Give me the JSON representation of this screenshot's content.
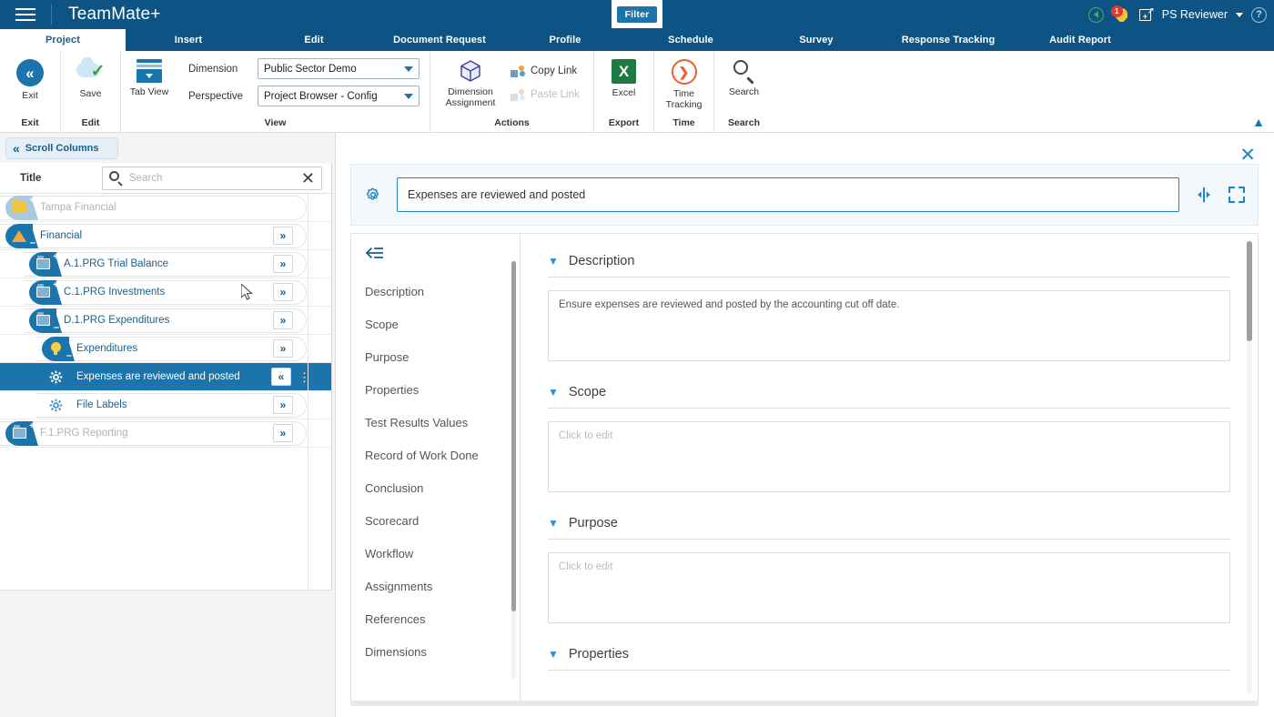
{
  "titlebar": {
    "app_title": "TeamMate+",
    "menu_icon": "hamburger-icon",
    "filter_label": "Filter",
    "user_name": "PS Reviewer",
    "notification_count": "1",
    "help_label": "?"
  },
  "ribbon_tabs": [
    {
      "label": "Project",
      "active": true
    },
    {
      "label": "Insert",
      "active": false
    },
    {
      "label": "Edit",
      "active": false
    },
    {
      "label": "Document Request",
      "active": false
    },
    {
      "label": "Profile",
      "active": false
    },
    {
      "label": "Schedule",
      "active": false
    },
    {
      "label": "Survey",
      "active": false
    },
    {
      "label": "Response Tracking",
      "active": false
    },
    {
      "label": "Audit Report",
      "active": false
    }
  ],
  "ribbon": {
    "groups": {
      "exit": {
        "group_label": "Exit",
        "button_label": "Exit"
      },
      "edit": {
        "group_label": "Edit",
        "button_label": "Save"
      },
      "view": {
        "group_label": "View",
        "tab_view_label": "Tab View",
        "dimension_label": "Dimension",
        "dimension_value": "Public Sector Demo",
        "perspective_label": "Perspective",
        "perspective_value": "Project Browser - Config"
      },
      "actions": {
        "group_label": "Actions",
        "dimension_assignment_label": "Dimension\nAssignment",
        "dimension_assignment_line1": "Dimension",
        "dimension_assignment_line2": "Assignment",
        "copy_link_label": "Copy Link",
        "paste_link_label": "Paste Link"
      },
      "export": {
        "group_label": "Export",
        "button_label": "Excel",
        "excel_glyph": "X"
      },
      "time": {
        "group_label": "Time",
        "line1": "Time",
        "line2": "Tracking"
      },
      "search": {
        "group_label": "Search",
        "button_label": "Search"
      }
    },
    "collapse_label": "^"
  },
  "left_pane": {
    "scroll_columns_label": "Scroll Columns",
    "column_header": "Title",
    "search_placeholder": "Search",
    "search_value": "",
    "rows": [
      {
        "label": "Tampa Financial",
        "indent": 0,
        "icon": "folder-plus-icon",
        "blob": "light",
        "disabled": true,
        "expand": "none",
        "selected": false
      },
      {
        "label": "Financial",
        "indent": 0,
        "icon": "triangle-icon",
        "blob": "blue",
        "disabled": false,
        "expand": "right",
        "selected": false
      },
      {
        "label": "A.1.PRG Trial Balance",
        "indent": 1,
        "icon": "folder-plus-icon",
        "blob": "blue",
        "disabled": false,
        "expand": "right",
        "selected": false
      },
      {
        "label": "C.1.PRG Investments",
        "indent": 1,
        "icon": "folder-plus-icon",
        "blob": "blue",
        "disabled": false,
        "expand": "right",
        "selected": false
      },
      {
        "label": "D.1.PRG Expenditures",
        "indent": 1,
        "icon": "folder-minus-icon",
        "blob": "blue",
        "disabled": false,
        "expand": "right",
        "selected": false
      },
      {
        "label": "Expenditures",
        "indent": 2,
        "icon": "bulb-icon",
        "blob": "blue",
        "disabled": false,
        "expand": "right",
        "selected": false
      },
      {
        "label": "Expenses are reviewed and posted",
        "indent": 3,
        "icon": "gear-white-icon",
        "blob": "none",
        "disabled": false,
        "expand": "left",
        "selected": true
      },
      {
        "label": "File Labels",
        "indent": 3,
        "icon": "gear-blue-icon",
        "blob": "none",
        "disabled": false,
        "expand": "right",
        "selected": false
      },
      {
        "label": "F.1.PRG Reporting",
        "indent": 0,
        "icon": "folder-plus-icon",
        "blob": "blue",
        "disabled": true,
        "expand": "right",
        "selected": false
      }
    ]
  },
  "detail": {
    "close_label": "✕",
    "gear_icon": "gear-icon",
    "title_value": "Expenses are reviewed and posted",
    "title_placeholder": "",
    "splitter_icon": "splitter-icon",
    "expand_icon": "fullscreen-icon",
    "collapse_nav_icon": "collapse-left-icon",
    "nav_items": [
      {
        "label": "Description"
      },
      {
        "label": "Scope"
      },
      {
        "label": "Purpose"
      },
      {
        "label": "Properties"
      },
      {
        "label": "Test Results Values"
      },
      {
        "label": "Record of Work Done"
      },
      {
        "label": "Conclusion"
      },
      {
        "label": "Scorecard"
      },
      {
        "label": "Workflow"
      },
      {
        "label": "Assignments"
      },
      {
        "label": "References"
      },
      {
        "label": "Dimensions"
      }
    ],
    "sections": [
      {
        "title": "Description",
        "value": "Ensure expenses are reviewed and posted by the accounting cut off date.",
        "placeholder": "",
        "empty": false
      },
      {
        "title": "Scope",
        "value": "",
        "placeholder": "Click to edit",
        "empty": true
      },
      {
        "title": "Purpose",
        "value": "",
        "placeholder": "Click to edit",
        "empty": true
      },
      {
        "title": "Properties",
        "value": "",
        "placeholder": "",
        "empty": true
      }
    ]
  },
  "colors": {
    "brand_dark": "#0d5484",
    "accent_blue": "#1b74ab",
    "link_blue": "#2185c5",
    "selected_row": "#1b74ab",
    "badge_red": "#e23b2e",
    "excel_green": "#1d7a43",
    "time_orange": "#e8622a"
  }
}
